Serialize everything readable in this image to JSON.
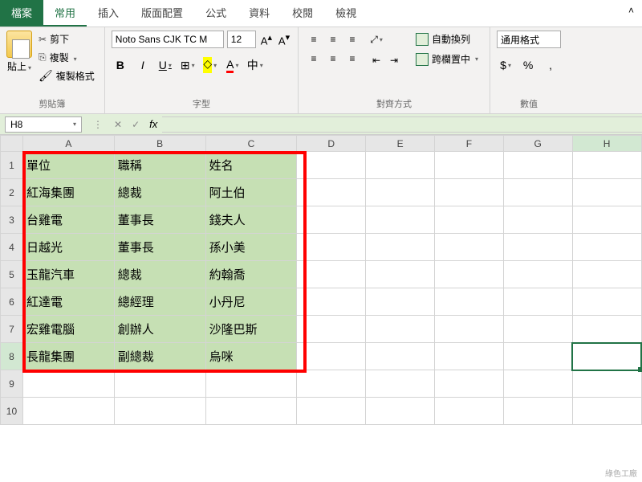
{
  "tabs": {
    "file": "檔案",
    "home": "常用",
    "insert": "插入",
    "layout": "版面配置",
    "formulas": "公式",
    "data": "資料",
    "review": "校閱",
    "view": "檢視"
  },
  "ribbon": {
    "clipboard": {
      "paste": "貼上",
      "cut": "剪下",
      "copy": "複製",
      "painter": "複製格式",
      "label": "剪貼簿"
    },
    "font": {
      "name": "Noto Sans CJK TC M",
      "size": "12",
      "bold": "B",
      "italic": "I",
      "underline": "U",
      "phonetic": "中",
      "label": "字型"
    },
    "align": {
      "wrap": "自動換列",
      "merge": "跨欄置中",
      "label": "對齊方式"
    },
    "number": {
      "format": "通用格式",
      "currency": "$",
      "percent": "%",
      "comma": ",",
      "label": "數值"
    }
  },
  "formulaBar": {
    "nameBox": "H8",
    "value": ""
  },
  "columns": [
    "A",
    "B",
    "C",
    "D",
    "E",
    "F",
    "G",
    "H"
  ],
  "rows": [
    "1",
    "2",
    "3",
    "4",
    "5",
    "6",
    "7",
    "8",
    "9",
    "10"
  ],
  "sheetData": [
    [
      "單位",
      "職稱",
      "姓名"
    ],
    [
      "紅海集團",
      "總裁",
      "阿土伯"
    ],
    [
      "台雞電",
      "董事長",
      "錢夫人"
    ],
    [
      "日越光",
      "董事長",
      "孫小美"
    ],
    [
      "玉龍汽車",
      "總裁",
      "約翰喬"
    ],
    [
      "紅達電",
      "總經理",
      "小丹尼"
    ],
    [
      "宏雞電腦",
      "創辦人",
      "沙隆巴斯"
    ],
    [
      "長龍集團",
      "副總裁",
      "烏咪"
    ]
  ],
  "watermark": "綠色工廠"
}
